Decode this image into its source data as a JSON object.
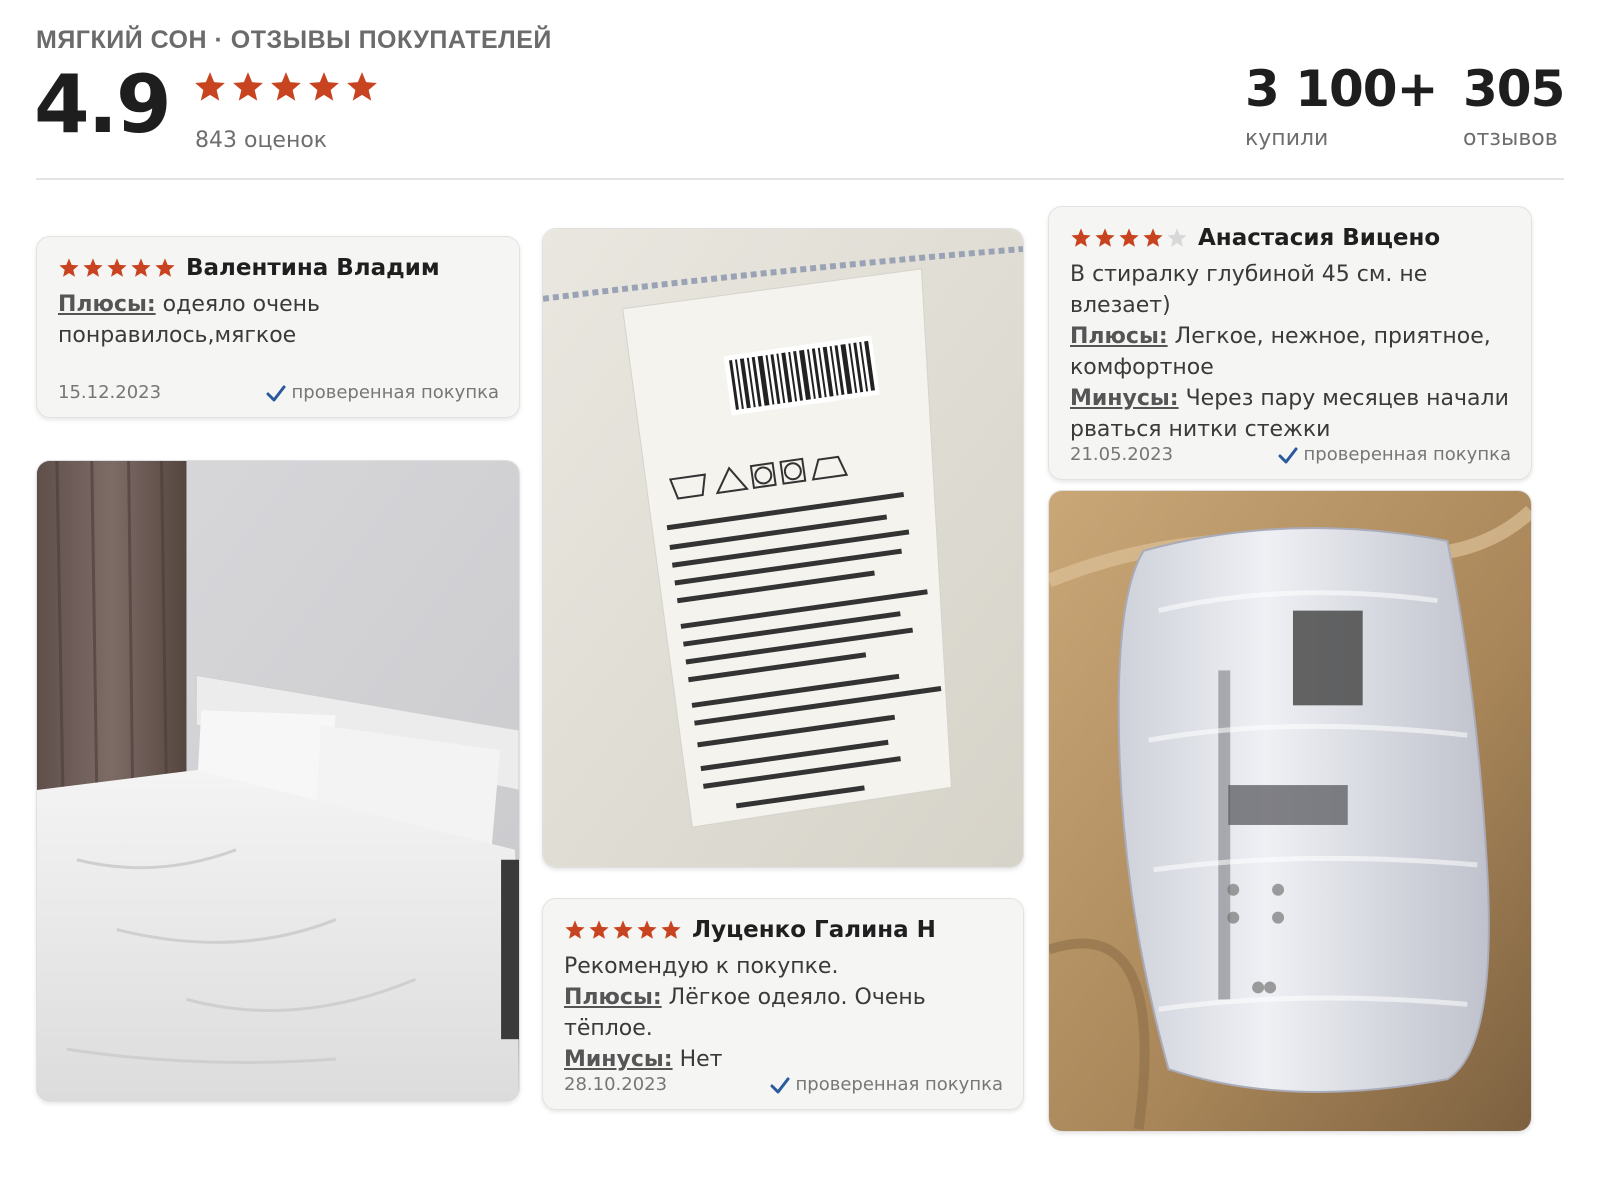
{
  "header": {
    "brand_title": "МЯГКИЙ СОН · ОТЗЫВЫ ПОКУПАТЕЛЕЙ",
    "rating": "4.9",
    "rating_stars": 5,
    "ratings_count": "843 оценок",
    "bought_value": "3 100+",
    "bought_label": "купили",
    "reviews_value": "305",
    "reviews_label": "отзывов"
  },
  "colors": {
    "star_filled": "#c8431f",
    "star_empty": "#d8d8d8",
    "check": "#2a5a9e",
    "card_bg": "#f5f5f3"
  },
  "reviews": [
    {
      "stars": 5,
      "author": "Валентина Владим",
      "pros_label": "Плюсы:",
      "pros": "одеяло очень понравилось,мягкое",
      "date": "15.12.2023",
      "verified": "проверенная покупка"
    },
    {
      "stars": 5,
      "author": "Луценко Галина Н",
      "text": "Рекомендую к покупке.",
      "pros_label": "Плюсы:",
      "pros": "Лёгкое одеяло. Очень тёплое.",
      "cons_label": "Минусы:",
      "cons": "Нет",
      "date": "28.10.2023",
      "verified": "проверенная покупка"
    },
    {
      "stars": 4,
      "author": "Анастасия Вицено",
      "text": "В стиралку глубиной 45 см. не влезает)",
      "pros_label": "Плюсы:",
      "pros": "Легкое, нежное, приятное, комфортное",
      "cons_label": "Минусы:",
      "cons": "Через пару месяцев начали рваться нитки стежки",
      "date": "21.05.2023",
      "verified": "проверенная покупка"
    }
  ],
  "photos": [
    {
      "alt": "bed-with-white-duvet"
    },
    {
      "alt": "sewn-in-product-label"
    },
    {
      "alt": "duvet-in-plastic-packaging"
    }
  ]
}
